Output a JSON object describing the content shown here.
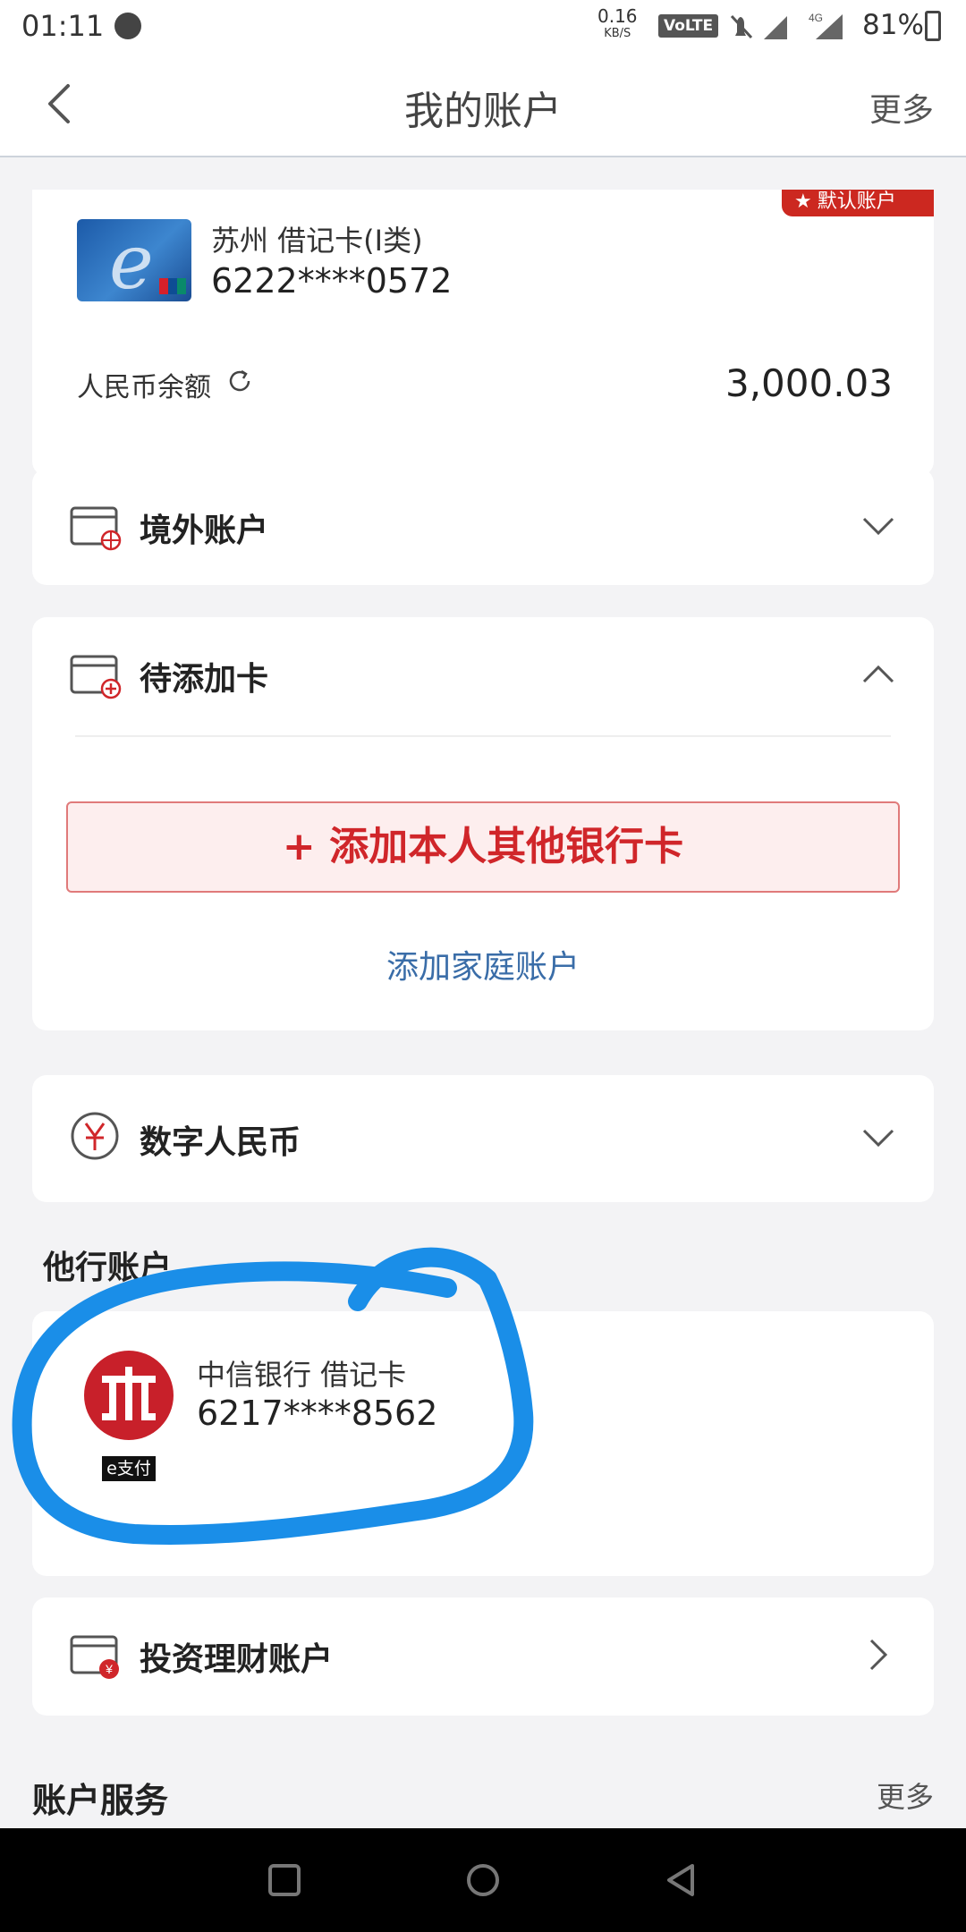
{
  "status_bar": {
    "time": "01:11",
    "net_speed": "0.16",
    "net_unit": "KB/S",
    "volte": "VoLTE",
    "network": "4G",
    "battery": "81%"
  },
  "header": {
    "title": "我的账户",
    "more": "更多"
  },
  "account_card": {
    "badge": "默认账户",
    "card_name": "苏州 借记卡(I类)",
    "card_number": "6222****0572",
    "balance_label": "人民币余额",
    "balance": "3,000.03"
  },
  "overseas": {
    "label": "境外账户"
  },
  "pending": {
    "label": "待添加卡",
    "add_card": "+ 添加本人其他银行卡",
    "add_family": "添加家庭账户"
  },
  "ecny": {
    "label": "数字人民币"
  },
  "other_bank": {
    "title": "他行账户",
    "bank_name": "中信银行 借记卡",
    "card_number": "6217****8562",
    "logo_tag": "e支付"
  },
  "invest": {
    "label": "投资理财账户"
  },
  "service": {
    "title": "账户服务",
    "more": "更多"
  },
  "colors": {
    "accent_red": "#d0262a",
    "link_blue": "#3a6da8",
    "annotation_blue": "#1a8ee8"
  }
}
